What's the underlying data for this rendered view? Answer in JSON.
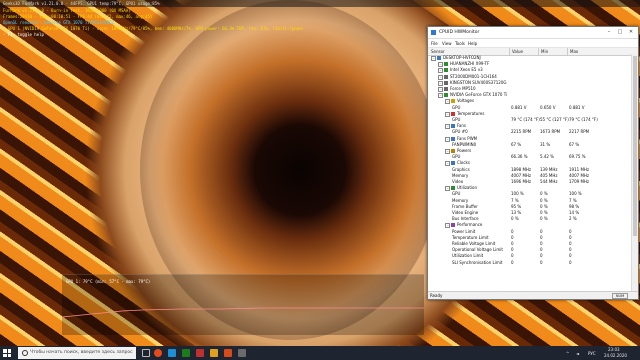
{
  "overlay": {
    "window_title": "Geeks3D FurMark v1.21.0.0 - 44FPS, GPU1 temp:79°C, GPU1 usage:85%",
    "lines": [
      "FurMark v1.21.0.0 - Burn-in test, 1920x1080 (0X MSAA)",
      "Frames:28410 - time:00:10:51 - FPS:44 (min:42, max:46, avg:45)",
      "OpenGL renderer: GeForce GTX 1070 Ti/PCIe/SSE2",
      "> GPU 1 (NVIDIA GeForce GTX 1070 Ti) - core: 1898MHz/79°C/85%, mem: 4006MHz/7%, GPU power: 66.3% TDP, fan: 67%, limits:[power:1, temp:0, volt:0, OV:0]",
      "- F1: toggle help"
    ]
  },
  "graph": {
    "label": "GPU 1: 79°C (min: 57°C - max: 79°C)"
  },
  "hwmonitor": {
    "title": "CPUID HWMonitor",
    "menu": [
      "File",
      "View",
      "Tools",
      "Help"
    ],
    "columns": [
      "Sensor",
      "Value",
      "Min",
      "Max"
    ],
    "rows": [
      {
        "level": 0,
        "name": "DESKTOP-HVFO2NJ",
        "icon": "computer-icon"
      },
      {
        "level": 1,
        "name": "HUANANZHI X99-TF",
        "icon": "motherboard-icon"
      },
      {
        "level": 1,
        "name": "Intel Xeon E5 v3",
        "icon": "cpu-icon"
      },
      {
        "level": 1,
        "name": "ST2000DM001-1CH164",
        "icon": "drive-icon"
      },
      {
        "level": 1,
        "name": "KINGSTON SUV400S37120G",
        "icon": "drive-icon"
      },
      {
        "level": 1,
        "name": "Force MP510",
        "icon": "drive-icon"
      },
      {
        "level": 1,
        "name": "NVIDIA GeForce GTX 1070 Ti",
        "icon": "gpu-icon"
      },
      {
        "level": 2,
        "name": "Voltages",
        "icon": "voltage-icon"
      },
      {
        "level": 3,
        "name": "GPU",
        "value": "0.881 V",
        "min": "0.650 V",
        "max": "0.881 V"
      },
      {
        "level": 2,
        "name": "Temperatures",
        "icon": "temperature-icon"
      },
      {
        "level": 3,
        "name": "GPU",
        "value": "79 °C  (174 °F)",
        "min": "55 °C  (127 °F)",
        "max": "79 °C  (174 °F)"
      },
      {
        "level": 2,
        "name": "Fans",
        "icon": "fan-icon"
      },
      {
        "level": 3,
        "name": "GPU #0",
        "value": "2215 RPM",
        "min": "1673 RPM",
        "max": "2217 RPM"
      },
      {
        "level": 2,
        "name": "Fans PWM",
        "icon": "fan-icon"
      },
      {
        "level": 3,
        "name": "FANPWMIN0",
        "value": "67 %",
        "min": "31 %",
        "max": "67 %"
      },
      {
        "level": 2,
        "name": "Powers",
        "icon": "power-icon"
      },
      {
        "level": 3,
        "name": "GPU",
        "value": "66.36 %",
        "min": "5.42 %",
        "max": "69.75 %"
      },
      {
        "level": 2,
        "name": "Clocks",
        "icon": "clock-icon"
      },
      {
        "level": 3,
        "name": "Graphics",
        "value": "1898 MHz",
        "min": "139 MHz",
        "max": "1911 MHz"
      },
      {
        "level": 3,
        "name": "Memory",
        "value": "4007 MHz",
        "min": "405 MHz",
        "max": "4007 MHz"
      },
      {
        "level": 3,
        "name": "Video",
        "value": "1696 MHz",
        "min": "544 MHz",
        "max": "1709 MHz"
      },
      {
        "level": 2,
        "name": "Utilization",
        "icon": "utilization-icon"
      },
      {
        "level": 3,
        "name": "GPU",
        "value": "100 %",
        "min": "0 %",
        "max": "100 %"
      },
      {
        "level": 3,
        "name": "Memory",
        "value": "7 %",
        "min": "0 %",
        "max": "7 %"
      },
      {
        "level": 3,
        "name": "Frame Buffer",
        "value": "95 %",
        "min": "0 %",
        "max": "98 %"
      },
      {
        "level": 3,
        "name": "Video Engine",
        "value": "13 %",
        "min": "0 %",
        "max": "14 %"
      },
      {
        "level": 3,
        "name": "Bus Interface",
        "value": "0 %",
        "min": "0 %",
        "max": "2 %"
      },
      {
        "level": 2,
        "name": "Performance",
        "icon": "performance-icon"
      },
      {
        "level": 3,
        "name": "Power Limit",
        "value": "0",
        "min": "0",
        "max": "0"
      },
      {
        "level": 3,
        "name": "Temperature Limit",
        "value": "0",
        "min": "0",
        "max": "0"
      },
      {
        "level": 3,
        "name": "Reliable Voltage Limit",
        "value": "0",
        "min": "0",
        "max": "0"
      },
      {
        "level": 3,
        "name": "Operational Voltage Limit",
        "value": "0",
        "min": "0",
        "max": "0"
      },
      {
        "level": 3,
        "name": "Utilization Limit",
        "value": "0",
        "min": "0",
        "max": "0"
      },
      {
        "level": 3,
        "name": "SLI Synchronisation Limit",
        "value": "0",
        "min": "0",
        "max": "0"
      }
    ],
    "status": "Ready",
    "num_indicator": "NUM"
  },
  "taskbar": {
    "search_placeholder": "Чтобы начать поиск, введите здесь запрос",
    "tray_lang": "РУС",
    "tray_time": "23:03",
    "tray_date": "24.02.2020"
  }
}
